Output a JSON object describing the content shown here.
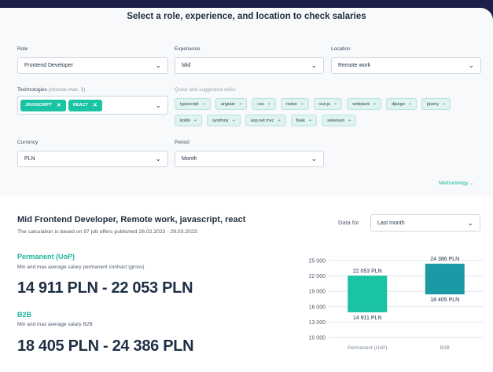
{
  "header": {
    "title": "Select a role, experience, and location to check salaries"
  },
  "filters": {
    "role": {
      "label": "Role",
      "value": "Frontend Developer"
    },
    "experience": {
      "label": "Experience",
      "value": "Mid"
    },
    "location": {
      "label": "Location",
      "value": "Remote work"
    },
    "technologies": {
      "label": "Technologies",
      "hint": "(choose max. 3)",
      "selected": [
        "JAVASCRIPT",
        "REACT"
      ]
    },
    "quick_add": {
      "label": "Quick add suggested skills:",
      "skills": [
        "typescript",
        "angular",
        "css",
        "redux",
        "vue.js",
        "webpack",
        "django",
        "jquery",
        "kotlin",
        "symfony",
        "asp.net mvc",
        "flask",
        "selenium"
      ]
    },
    "currency": {
      "label": "Currency",
      "value": "PLN"
    },
    "period": {
      "label": "Period",
      "value": "Month"
    }
  },
  "methodology_link": "Methodology",
  "results": {
    "title": "Mid Frontend Developer, Remote work, javascript, react",
    "subtitle": "The calculation is based on 97 job offers published 28.02.2023 - 29.03.2023.",
    "data_for": {
      "label": "Data for",
      "value": "Last month"
    },
    "permanent": {
      "title": "Permanent (UoP)",
      "desc": "Min and max average salary permanent contract (gross)",
      "range": "14 911 PLN - 22 053 PLN"
    },
    "b2b": {
      "title": "B2B",
      "desc": "Min and max average salary B2B",
      "range": "18 405 PLN - 24 386 PLN"
    }
  },
  "chart_data": {
    "type": "bar",
    "categories": [
      "Permanent (UoP)",
      "B2B"
    ],
    "series": [
      {
        "min": 14911,
        "max": 22053,
        "min_label": "14 911 PLN",
        "max_label": "22 053 PLN",
        "color": "#19c3a3"
      },
      {
        "min": 18405,
        "max": 24386,
        "min_label": "18 405 PLN",
        "max_label": "24 386 PLN",
        "color": "#1b9aa6"
      }
    ],
    "yticks": [
      10000,
      13000,
      16000,
      19000,
      22000,
      25000
    ],
    "ytick_labels": [
      "10 000",
      "13 000",
      "16 000",
      "19 000",
      "22 000",
      "25 000"
    ],
    "ylim": [
      10000,
      25000
    ],
    "grid": true
  },
  "colors": {
    "accent": "#19c3a3",
    "dark": "#1b1f4a"
  }
}
